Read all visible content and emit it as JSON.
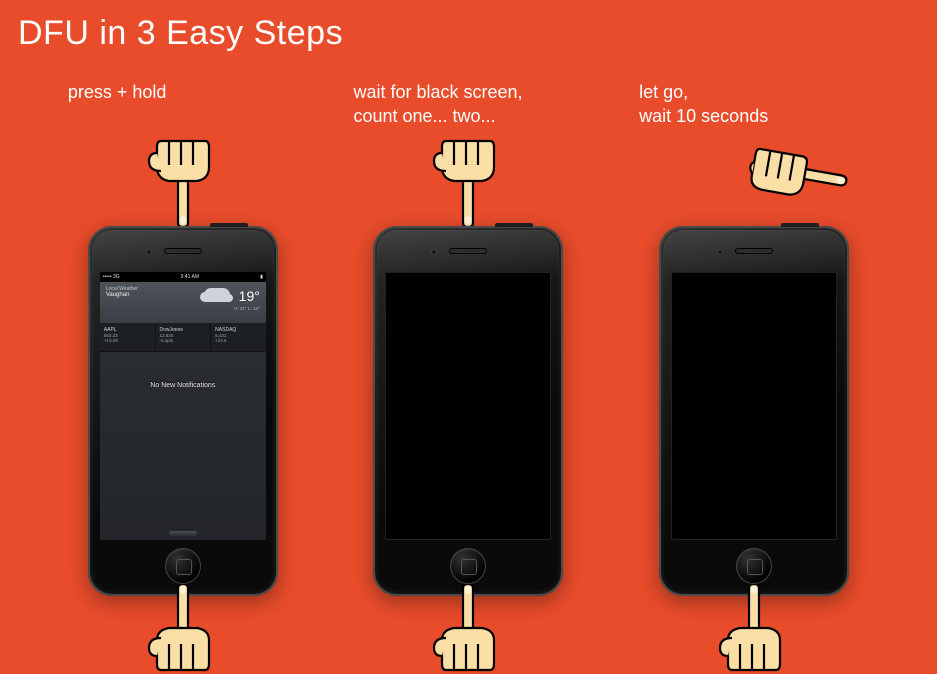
{
  "title": "DFU in 3 Easy Steps",
  "steps": [
    {
      "caption": "press + hold",
      "top_hand": "pointing-down",
      "bottom_hand": "pointing-up",
      "screen": "notification-center"
    },
    {
      "caption": "wait for black screen,\ncount one... two...",
      "top_hand": "pointing-down",
      "bottom_hand": "pointing-up",
      "screen": "black"
    },
    {
      "caption": "let go,\nwait 10 seconds",
      "top_hand": "pointing-away",
      "bottom_hand": "pointing-up",
      "screen": "black"
    }
  ],
  "nc": {
    "status_left": "••••• 3G",
    "status_time": "9:41 AM",
    "weather_label": "Local Weather",
    "city": "Vaughan",
    "temp": "19°",
    "high_low": "H: 21°   L: 14°",
    "stocks": [
      {
        "sym": "AAPL",
        "val": "563.23",
        "chg": "+13.29"
      },
      {
        "sym": "DowJones",
        "val": "12,820",
        "chg": "-5.4pts"
      },
      {
        "sym": "NASDAQ",
        "val": "5,431",
        "chg": "+24.6"
      }
    ],
    "no_new": "No New Notifications"
  }
}
